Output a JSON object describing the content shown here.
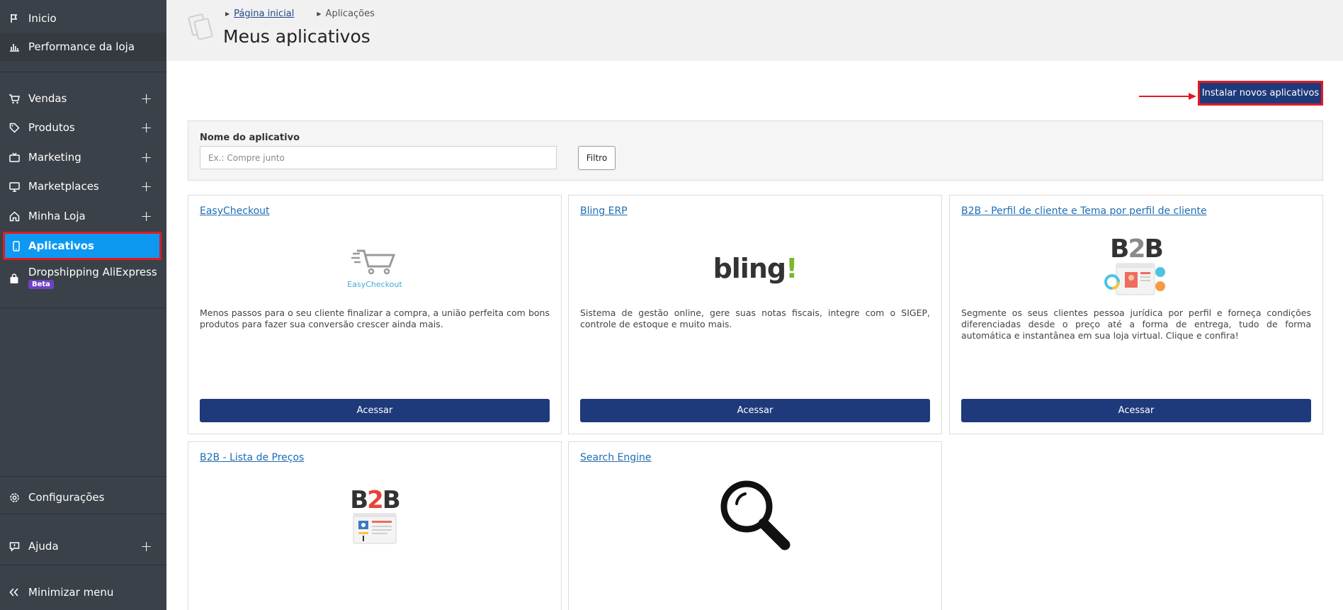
{
  "sidebar": {
    "items": [
      {
        "label": "Inicio",
        "icon": "flag-icon"
      },
      {
        "label": "Performance da loja",
        "icon": "bar-chart-icon"
      },
      {
        "label": "Vendas",
        "icon": "cart-icon"
      },
      {
        "label": "Produtos",
        "icon": "tag-icon"
      },
      {
        "label": "Marketing",
        "icon": "tv-icon"
      },
      {
        "label": "Marketplaces",
        "icon": "monitor-icon"
      },
      {
        "label": "Minha Loja",
        "icon": "home-icon"
      },
      {
        "label": "Aplicativos",
        "icon": "phone-icon"
      },
      {
        "label": "Dropshipping AliExpress",
        "icon": "bag-icon",
        "badge": "Beta"
      },
      {
        "label": "Configurações",
        "icon": "gear-icon"
      },
      {
        "label": "Ajuda",
        "icon": "help-icon"
      },
      {
        "label": "Minimizar menu",
        "icon": "double-chevron-left-icon"
      }
    ],
    "expand_symbol": "+",
    "active_color": "#0d99f2",
    "background": "#3b4148"
  },
  "header": {
    "breadcrumbs": [
      "Página inicial",
      "Aplicações"
    ],
    "title": "Meus aplicativos"
  },
  "install_button": {
    "label": "Instalar novos aplicativos"
  },
  "filter": {
    "label": "Nome do aplicativo",
    "placeholder": "Ex.: Compre junto",
    "button": "Filtro"
  },
  "apps": [
    {
      "title": "EasyCheckout",
      "logo_text": "EasyCheckout",
      "description": "Menos passos para o seu cliente finalizar a compra, a união perfeita com bons produtos para fazer sua conversão crescer ainda mais.",
      "button": "Acessar"
    },
    {
      "title": "Bling ERP",
      "logo_text": "bling!",
      "description": "Sistema de gestão online, gere suas notas fiscais, integre com o SIGEP, controle de estoque e muito mais.",
      "button": "Acessar"
    },
    {
      "title": "B2B - Perfil de cliente e Tema por perfil de cliente",
      "logo_text": "B2B",
      "description": "Segmente os seus clientes pessoa jurídica por perfil e forneça condições diferenciadas desde o preço até a forma de entrega, tudo de forma automática e instantânea em sua loja virtual. Clique e confira!",
      "button": "Acessar"
    },
    {
      "title": "B2B - Lista de Preços",
      "logo_text": "B2B"
    },
    {
      "title": "Search Engine",
      "logo": "magnifier-icon"
    }
  ],
  "colors": {
    "primary_button": "#1e3a7b",
    "highlight_outline": "#e01b24",
    "link": "#1f6db3"
  }
}
